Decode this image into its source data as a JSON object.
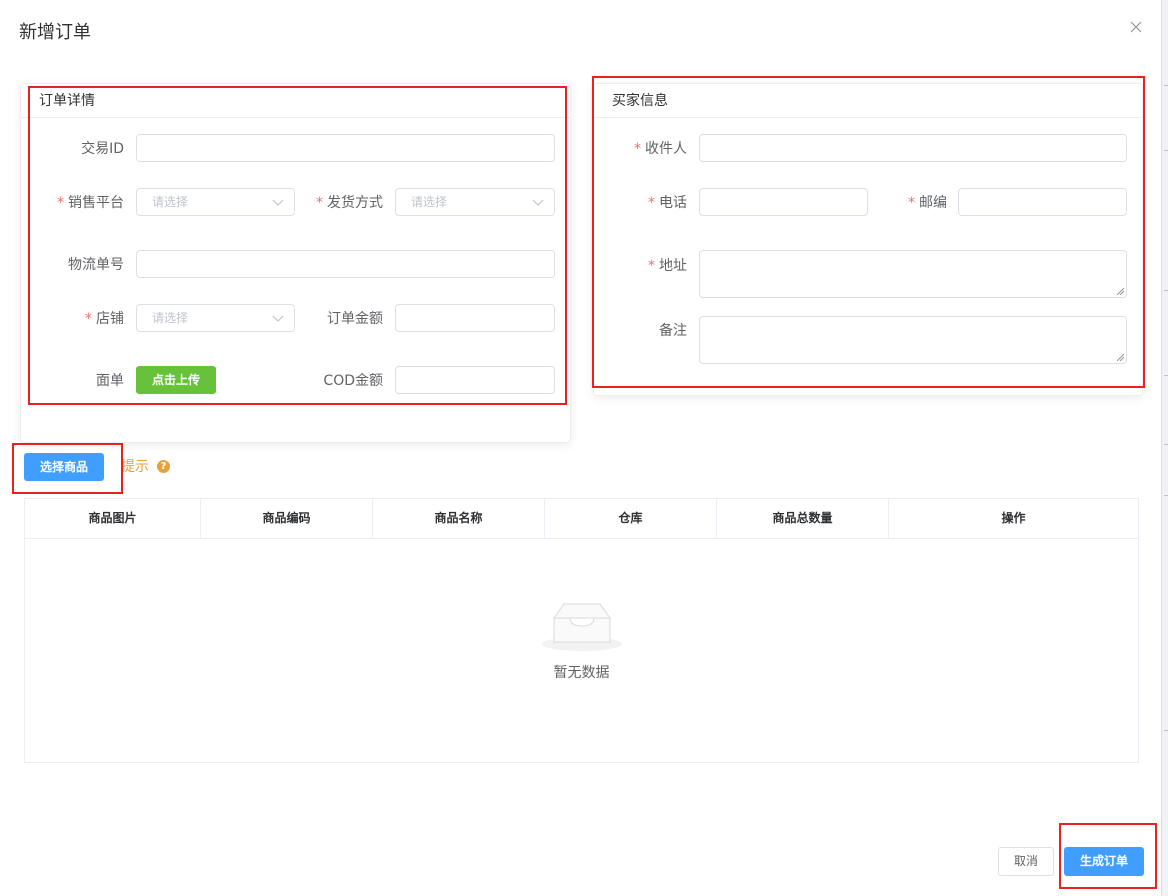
{
  "dialog": {
    "title": "新增订单"
  },
  "order_section": {
    "title": "订单详情",
    "transaction_id_label": "交易ID",
    "platform_label": "销售平台",
    "platform_placeholder": "请选择",
    "shipping_label": "发货方式",
    "shipping_placeholder": "请选择",
    "tracking_label": "物流单号",
    "store_label": "店铺",
    "store_placeholder": "请选择",
    "amount_label": "订单金额",
    "waybill_label": "面单",
    "upload_button": "点击上传",
    "cod_label": "COD金额"
  },
  "buyer_section": {
    "title": "买家信息",
    "recipient_label": "收件人",
    "phone_label": "电话",
    "postcode_label": "邮编",
    "address_label": "地址",
    "remark_label": "备注"
  },
  "goods": {
    "select_button": "选择商品",
    "hint": "提示",
    "hint_icon": "?",
    "columns": [
      "商品图片",
      "商品编码",
      "商品名称",
      "仓库",
      "商品总数量",
      "操作"
    ],
    "empty_text": "暂无数据"
  },
  "footer": {
    "cancel_button": "取消",
    "submit_button": "生成订单"
  },
  "required_mark": "*",
  "colors": {
    "primary": "#409eff",
    "success": "#67c23a",
    "warning": "#e6a23c",
    "required": "#f56c6c",
    "highlight_box": "#e8231f"
  }
}
